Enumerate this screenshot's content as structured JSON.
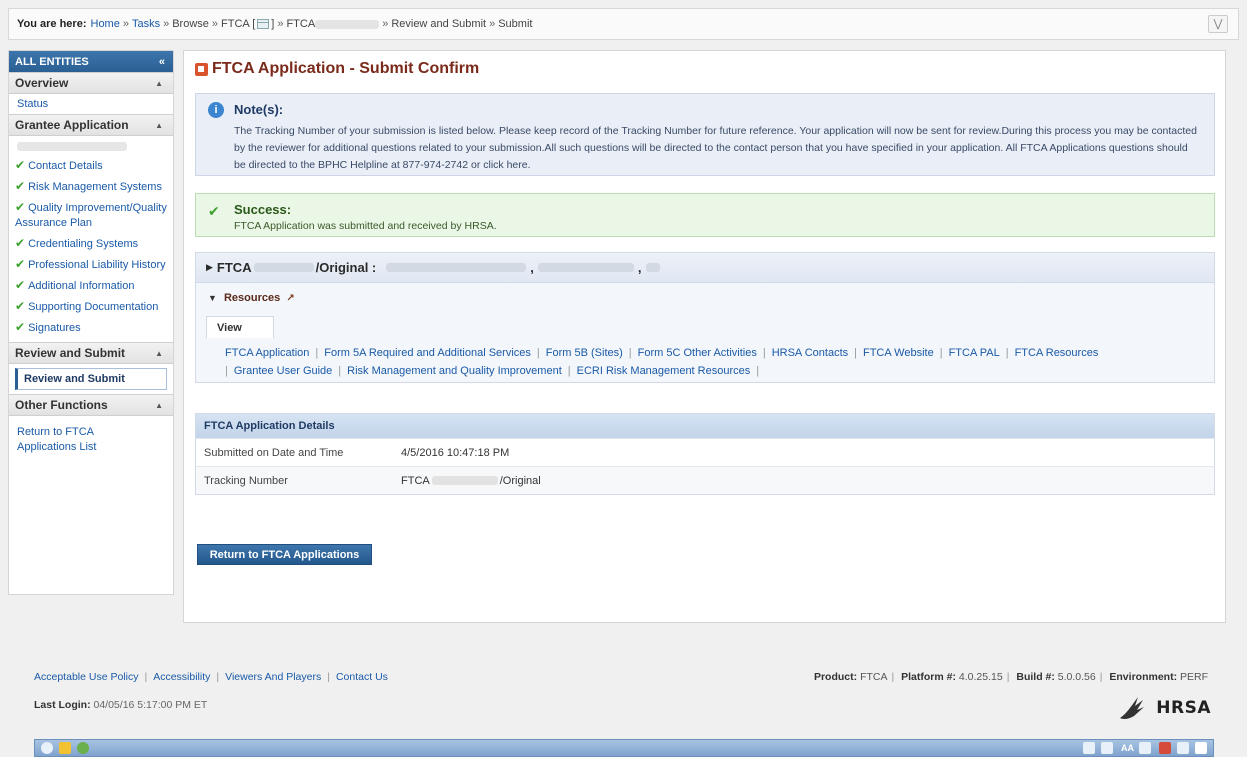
{
  "breadcrumb": {
    "label": "You are here:",
    "home": "Home",
    "tasks": "Tasks",
    "browse": "Browse",
    "ftca_bracket": "FTCA [",
    "ftca_bracket_close": "]",
    "ftca_prefix": "FTCA",
    "review": "Review and Submit",
    "submit": "Submit",
    "separator": "»"
  },
  "sidebar": {
    "title": "ALL ENTITIES",
    "collapse_glyph": "«",
    "overview": {
      "label": "Overview",
      "items": [
        {
          "label": "Status"
        }
      ]
    },
    "grantee": {
      "label": "Grantee Application",
      "items": [
        {
          "label": "Contact Details"
        },
        {
          "label": "Risk Management Systems"
        },
        {
          "label": "Quality Improvement/Quality Assurance Plan"
        },
        {
          "label": "Credentialing Systems"
        },
        {
          "label": "Professional Liability History"
        },
        {
          "label": "Additional Information"
        },
        {
          "label": "Supporting Documentation"
        },
        {
          "label": "Signatures"
        }
      ]
    },
    "review": {
      "label": "Review and Submit",
      "active_item": "Review and Submit"
    },
    "other": {
      "label": "Other Functions",
      "items": [
        {
          "label": "Return to FTCA Applications List"
        }
      ]
    }
  },
  "page": {
    "title": "FTCA Application - Submit Confirm",
    "note_heading": "Note(s):",
    "note_body": "The Tracking Number of your submission is listed below. Please keep record of the Tracking Number for future reference. Your application will now be sent for review.During this process you may be contacted by the reviewer for additional questions related to your submission.All such questions will be directed to the contact person that you have specified in your application. All FTCA Applications questions should be directed to the BPHC Helpline at 877-974-2742 or click here.",
    "success_heading": "Success:",
    "success_body": "FTCA Application was submitted and received by HRSA.",
    "app_prefix": "FTCA",
    "app_suffix": "/Original :",
    "resources_label": "Resources",
    "view_tab": "View",
    "resource_links": [
      "FTCA Application",
      "Form 5A Required and Additional Services",
      "Form 5B (Sites)",
      "Form 5C Other Activities",
      "HRSA Contacts",
      "FTCA Website",
      "FTCA PAL",
      "FTCA Resources",
      "Grantee User Guide",
      "Risk Management and Quality Improvement",
      "ECRI Risk Management Resources"
    ],
    "details_heading": "FTCA Application Details",
    "details": [
      {
        "key": "Submitted on Date and Time",
        "value": "4/5/2016 10:47:18 PM"
      },
      {
        "key": "Tracking Number",
        "value_prefix": "FTCA",
        "value_suffix": "/Original"
      }
    ],
    "return_button": "Return to FTCA Applications"
  },
  "footer": {
    "links": [
      "Acceptable Use Policy",
      "Accessibility",
      "Viewers And Players",
      "Contact Us"
    ],
    "last_login_label": "Last Login:",
    "last_login_value": "04/05/16 5:17:00 PM ET",
    "product_label": "Product:",
    "product_value": "FTCA",
    "platform_label": "Platform #:",
    "platform_value": "4.0.25.15",
    "build_label": "Build #:",
    "build_value": "5.0.0.56",
    "env_label": "Environment:",
    "env_value": "PERF",
    "brand": "HRSA"
  },
  "colors": {
    "accent": "#2a5f93",
    "title": "#7a2a1a",
    "link": "#1a5aa8",
    "success": "#3ca12e"
  }
}
